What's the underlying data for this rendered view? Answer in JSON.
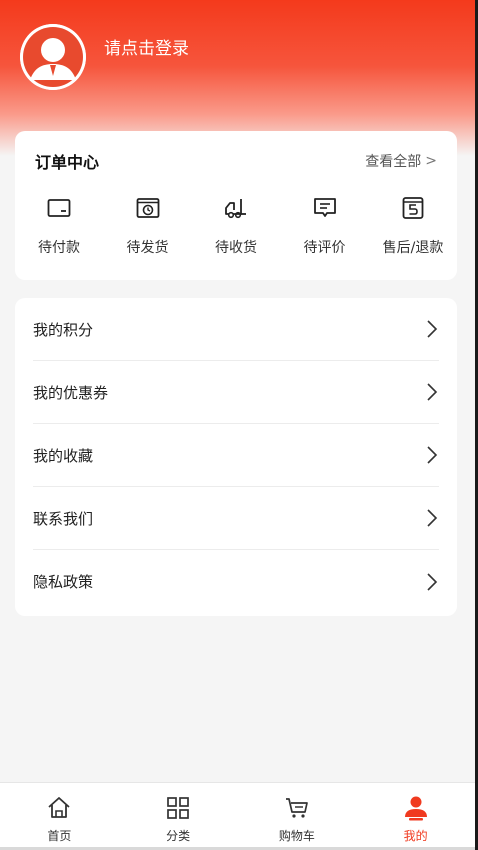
{
  "colors": {
    "brand": "#f43a1c",
    "active_tab": "#f03a1f"
  },
  "header": {
    "login_text": "请点击登录",
    "avatar_icon": "user-avatar-icon"
  },
  "orders": {
    "title": "订单中心",
    "view_all": "查看全部",
    "items": [
      {
        "label": "待付款",
        "icon": "wallet-icon"
      },
      {
        "label": "待发货",
        "icon": "box-clock-icon"
      },
      {
        "label": "待收货",
        "icon": "truck-icon"
      },
      {
        "label": "待评价",
        "icon": "comment-icon"
      },
      {
        "label": "售后/退款",
        "icon": "refund-icon"
      }
    ]
  },
  "menu": {
    "items": [
      {
        "label": "我的积分"
      },
      {
        "label": "我的优惠券"
      },
      {
        "label": "我的收藏"
      },
      {
        "label": "联系我们"
      },
      {
        "label": "隐私政策"
      }
    ]
  },
  "tabbar": {
    "tabs": [
      {
        "label": "首页",
        "icon": "home-icon"
      },
      {
        "label": "分类",
        "icon": "grid-icon"
      },
      {
        "label": "购物车",
        "icon": "cart-icon"
      },
      {
        "label": "我的",
        "icon": "person-icon",
        "active": true
      }
    ]
  }
}
